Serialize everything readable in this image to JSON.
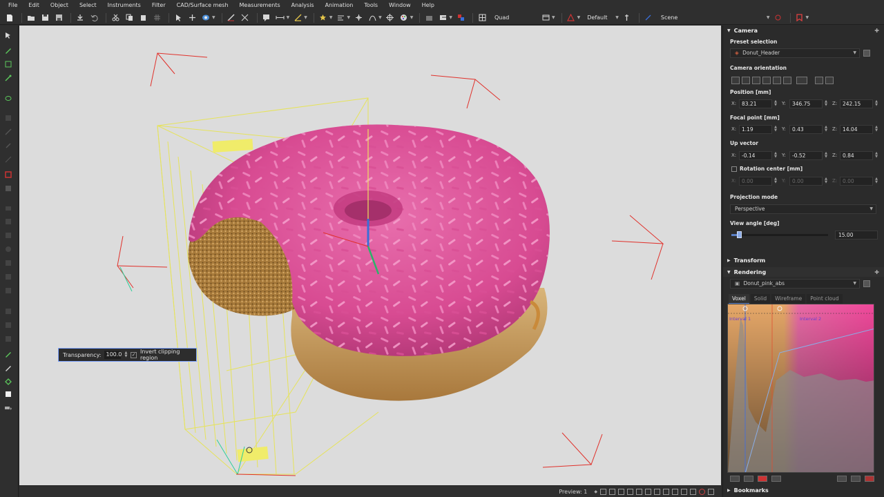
{
  "menu": [
    "File",
    "Edit",
    "Object",
    "Select",
    "Instruments",
    "Filter",
    "CAD/Surface mesh",
    "Measurements",
    "Analysis",
    "Animation",
    "Tools",
    "Window",
    "Help"
  ],
  "toolbar": {
    "layout_label": "Quad",
    "preset_label": "Default",
    "scene_label": "Scene"
  },
  "viewport": {
    "background": "#dcdcdc",
    "transparency_label": "Transparency:",
    "transparency_value": "100.0",
    "invert_label": "Invert clipping region",
    "invert_checked": true
  },
  "statusbar": {
    "preview_label": "Preview: 1"
  },
  "camera": {
    "title": "Camera",
    "preset_selection_label": "Preset selection",
    "preset_value": "Donut_Header",
    "orientation_label": "Camera orientation",
    "position_label": "Position [mm]",
    "position": {
      "x": "83.21",
      "y": "346.75",
      "z": "242.15"
    },
    "focal_label": "Focal point [mm]",
    "focal": {
      "x": "1.19",
      "y": "0.43",
      "z": "14.04"
    },
    "up_label": "Up vector",
    "up": {
      "x": "-0.14",
      "y": "-0.52",
      "z": "0.84"
    },
    "rotation_label": "Rotation center [mm]",
    "rotation": {
      "x": "0.00",
      "y": "0.00",
      "z": "0.00"
    },
    "rotation_enabled": false,
    "projection_label": "Projection mode",
    "projection_value": "Perspective",
    "view_angle_label": "View angle [deg]",
    "view_angle_value": "15.00"
  },
  "transform": {
    "title": "Transform"
  },
  "rendering": {
    "title": "Rendering",
    "object_value": "Donut_pink_abs",
    "tabs": [
      "Voxel",
      "Solid",
      "Wireframe",
      "Point cloud"
    ],
    "active_tab": "Voxel",
    "interval1_label": "Interval 1",
    "interval2_label": "Interval 2"
  },
  "bookmarks": {
    "title": "Bookmarks"
  },
  "axis_labels": {
    "x": "X:",
    "y": "Y:",
    "z": "Z:"
  },
  "colors": {
    "accent": "#5a7fc4",
    "icing": "#e0559d",
    "dough": "#c99a4f",
    "clip_box": "#e6e35a",
    "gizmo": "#e0302a"
  }
}
